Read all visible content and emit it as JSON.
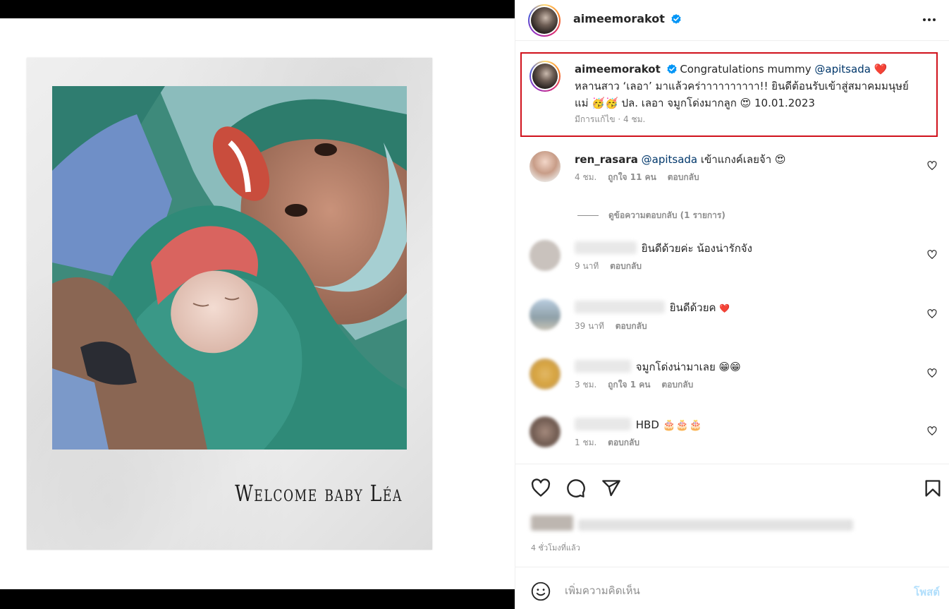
{
  "media": {
    "caption_text": "Welcome baby Léa"
  },
  "header": {
    "username": "aimeemorakot",
    "verified": true
  },
  "caption": {
    "username": "aimeemorakot",
    "text_1": "Congratulations mummy",
    "mention": "@apitsada",
    "heart": "❤️",
    "line_2": "หลานสาว ‘เลอา’ มาแล้วคร่าาาาาาาาาา!! ยินดีต้อนรับเข้าสู่สมาคมมนุษย์",
    "line_3_start": "แม่",
    "line_3_emojis": "🥳🥳",
    "line_3_mid": "ปล. เลอา จมูกโด่งมากลูก",
    "line_3_emoji2": "😍",
    "line_3_date": "10.01.2023",
    "meta": "มีการแก้ไข · 4 ชม."
  },
  "comments": [
    {
      "username": "ren_rasara",
      "mention": "@apitsada",
      "text": "เข้าแกงค์เลยจ้า",
      "emoji": "😍",
      "time": "4 ชม.",
      "likes": "ถูกใจ 11 คน",
      "reply": "ตอบกลับ",
      "blurred_user": false
    },
    {
      "username": "",
      "text": "ยินดีด้วยค่ะ น้องน่ารักจัง",
      "time": "9 นาที",
      "likes": "",
      "reply": "ตอบกลับ",
      "blurred_user": true
    },
    {
      "username": "",
      "text": "ยินดีด้วยค",
      "emoji": "❤️",
      "time": "39 นาที",
      "likes": "",
      "reply": "ตอบกลับ",
      "blurred_user": true
    },
    {
      "username": "",
      "text": "จมูกโด่งน่ามาเลย",
      "emoji": "😁😁",
      "time": "3 ชม.",
      "likes": "ถูกใจ 1 คน",
      "reply": "ตอบกลับ",
      "blurred_user": true
    },
    {
      "username": "",
      "text": "HBD 🎂🎂🎂",
      "time": "1 ชม.",
      "likes": "",
      "reply": "ตอบกลับ",
      "blurred_user": true
    }
  ],
  "view_replies": "ดูข้อความตอบกลับ (1 รายการ)",
  "actions": {
    "like_icon": "heart-icon",
    "comment_icon": "comment-icon",
    "share_icon": "send-icon",
    "save_icon": "bookmark-icon"
  },
  "timestamp": "4 ชั่วโมงที่แล้ว",
  "add_comment": {
    "placeholder": "เพิ่มความคิดเห็น",
    "post_label": "โพสต์"
  },
  "colors": {
    "highlight_border": "#d0121c",
    "mention": "#00376b",
    "verified": "#0095f6",
    "post_button": "#b2dffc"
  }
}
